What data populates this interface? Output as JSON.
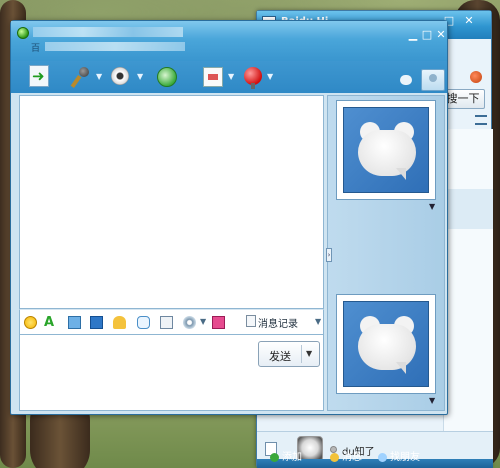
{
  "hi_window": {
    "title": "Baidu Hi",
    "search_button_label": "搜一下",
    "contact": {
      "name": "du知了"
    },
    "bottom_bar": {
      "add_label": "添加",
      "messages_label": "消息",
      "find_friends_label": "找朋友"
    }
  },
  "chat_window": {
    "subtitle_prefix": "百",
    "input_toolbar": {
      "history_label": "消息记录"
    },
    "send_button_label": "发送"
  },
  "colors": {
    "titlebar_blue": "#3a96cf",
    "online_green": "#2f9a18",
    "panel_blue": "#a9cde6"
  },
  "icons": {
    "toolbar": [
      "send-file-icon",
      "microphone-icon",
      "webcam-icon",
      "app-share-icon",
      "file-transfer-icon",
      "game-icon",
      "bubble-icon",
      "profile-icon"
    ],
    "input": [
      "emoticon-icon",
      "font-icon",
      "screenshot-icon",
      "dice-icon",
      "shake-icon",
      "chat-style-icon",
      "note-icon",
      "settings-icon",
      "gift-icon"
    ]
  }
}
